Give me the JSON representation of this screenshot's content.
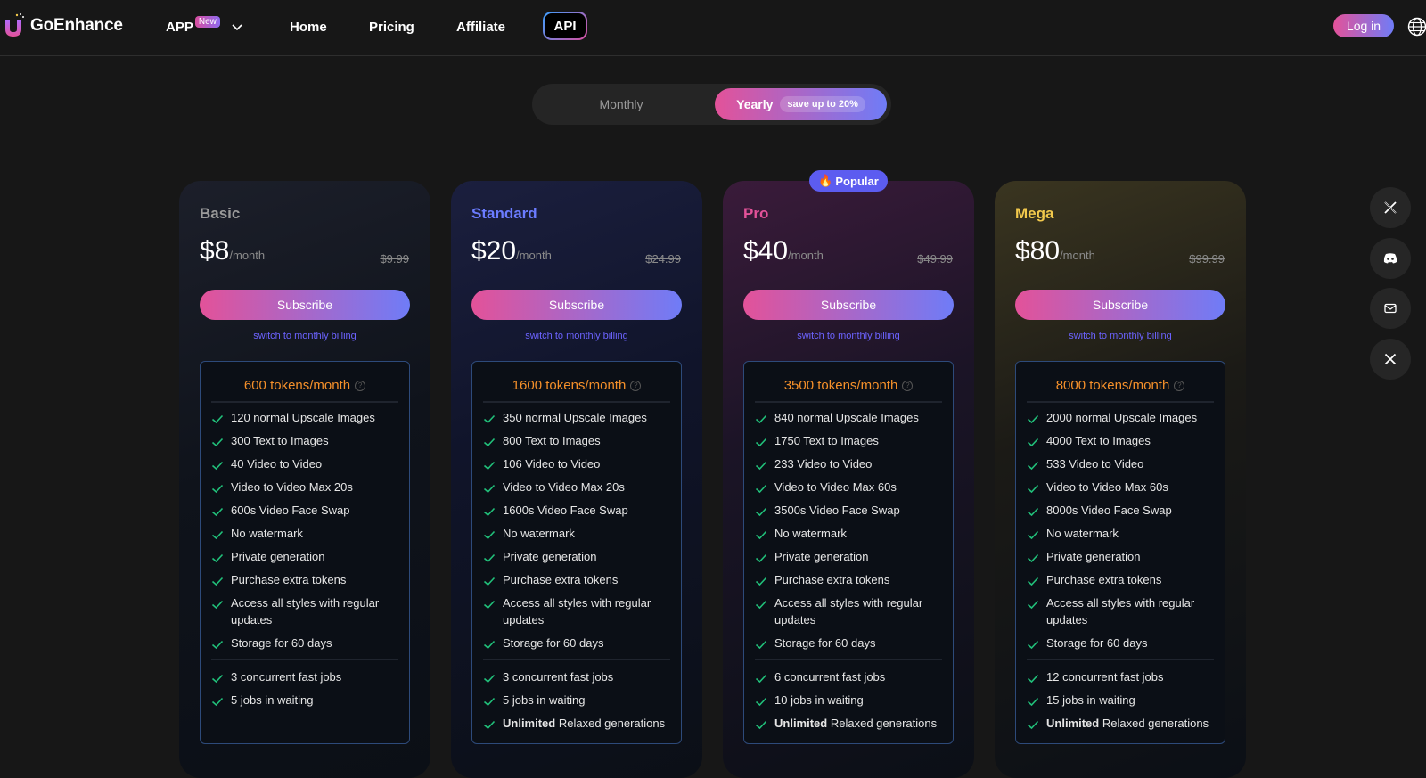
{
  "header": {
    "brand": "GoEnhance",
    "nav": {
      "app": "APP",
      "app_badge": "New",
      "home": "Home",
      "pricing": "Pricing",
      "affiliate": "Affiliate",
      "api": "API"
    },
    "login": "Log in",
    "language_icon": "globe-icon"
  },
  "billing_toggle": {
    "monthly": "Monthly",
    "yearly": "Yearly",
    "yearly_badge": "save up to 20%",
    "selected": "Yearly"
  },
  "popular_badge": {
    "emoji": "🔥",
    "label": "Popular"
  },
  "colors": {
    "accent_gradient_start": "#e35299",
    "accent_gradient_end": "#6f7cf7",
    "basic": "#9a9a9a",
    "standard": "#6b7cff",
    "pro": "#e35299",
    "mega": "#f2c94c",
    "tokens": "#f5902a",
    "check": "#21c07a"
  },
  "plans": [
    {
      "name": "Basic",
      "price": "$8",
      "unit": "/month",
      "old_price": "$9.99",
      "subscribe": "Subscribe",
      "switch": "switch to monthly billing",
      "tokens": "600 tokens/month",
      "features": [
        "120 normal Upscale Images",
        "300 Text to Images",
        "40 Video to Video",
        "Video to Video Max 20s",
        "600s Video Face Swap",
        "No watermark",
        "Private generation",
        "Purchase extra tokens",
        "Access all styles with regular updates",
        "Storage for 60 days"
      ],
      "jobs": [
        "3 concurrent fast jobs",
        "5 jobs in waiting"
      ]
    },
    {
      "name": "Standard",
      "price": "$20",
      "unit": "/month",
      "old_price": "$24.99",
      "subscribe": "Subscribe",
      "switch": "switch to monthly billing",
      "tokens": "1600 tokens/month",
      "features": [
        "350 normal Upscale Images",
        "800 Text to Images",
        "106 Video to Video",
        "Video to Video Max 20s",
        "1600s Video Face Swap",
        "No watermark",
        "Private generation",
        "Purchase extra tokens",
        "Access all styles with regular updates",
        "Storage for 60 days"
      ],
      "jobs": [
        "3 concurrent fast jobs",
        "5 jobs in waiting"
      ],
      "unlimited_bold": "Unlimited",
      "unlimited_rest": " Relaxed generations"
    },
    {
      "name": "Pro",
      "price": "$40",
      "unit": "/month",
      "old_price": "$49.99",
      "subscribe": "Subscribe",
      "switch": "switch to monthly billing",
      "tokens": "3500 tokens/month",
      "features": [
        "840 normal Upscale Images",
        "1750 Text to Images",
        "233 Video to Video",
        "Video to Video Max 60s",
        "3500s Video Face Swap",
        "No watermark",
        "Private generation",
        "Purchase extra tokens",
        "Access all styles with regular updates",
        "Storage for 60 days"
      ],
      "jobs": [
        "6 concurrent fast jobs",
        "10 jobs in waiting"
      ],
      "unlimited_bold": "Unlimited",
      "unlimited_rest": " Relaxed generations"
    },
    {
      "name": "Mega",
      "price": "$80",
      "unit": "/month",
      "old_price": "$99.99",
      "subscribe": "Subscribe",
      "switch": "switch to monthly billing",
      "tokens": "8000 tokens/month",
      "features": [
        "2000 normal Upscale Images",
        "4000 Text to Images",
        "533 Video to Video",
        "Video to Video Max 60s",
        "8000s Video Face Swap",
        "No watermark",
        "Private generation",
        "Purchase extra tokens",
        "Access all styles with regular updates",
        "Storage for 60 days"
      ],
      "jobs": [
        "12 concurrent fast jobs",
        "15 jobs in waiting"
      ],
      "unlimited_bold": "Unlimited",
      "unlimited_rest": " Relaxed generations"
    }
  ],
  "side_actions": [
    {
      "icon": "x-twitter-icon"
    },
    {
      "icon": "discord-icon"
    },
    {
      "icon": "mail-icon"
    },
    {
      "icon": "close-icon"
    }
  ]
}
